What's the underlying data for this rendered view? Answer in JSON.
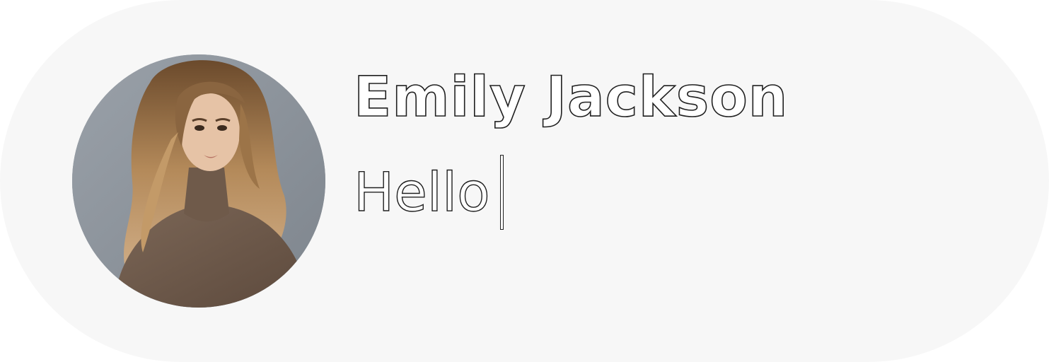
{
  "profile": {
    "name": "Emily Jackson",
    "avatar_icon": "profile-photo",
    "message": "Hello"
  },
  "colors": {
    "card_background": "#f7f7f7",
    "text_fill": "#ffffff",
    "text_outline": "#1f1f1f"
  }
}
